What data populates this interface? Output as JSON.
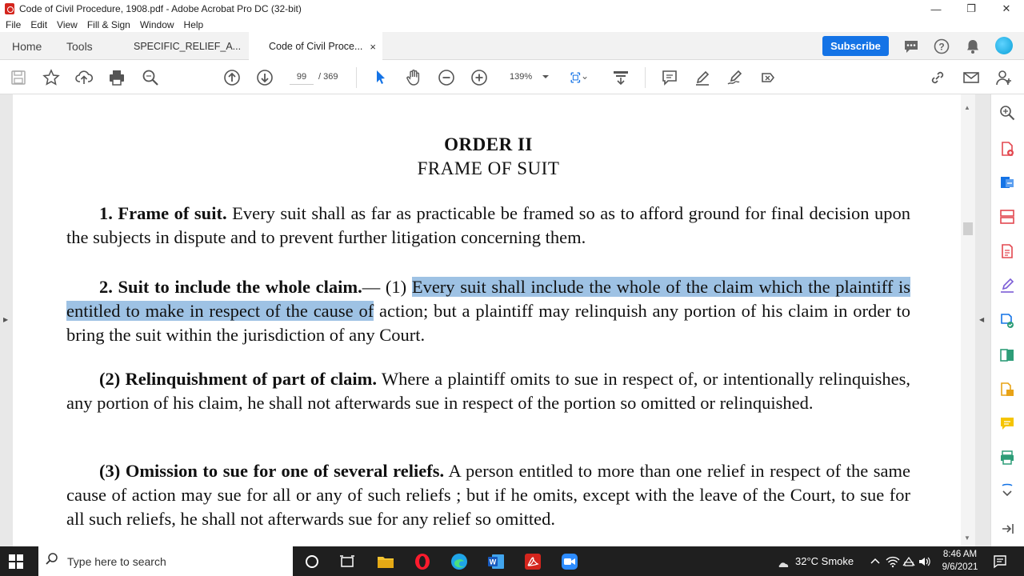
{
  "window": {
    "title": "Code of Civil Procedure, 1908.pdf - Adobe Acrobat Pro DC (32-bit)"
  },
  "menu": [
    "File",
    "Edit",
    "View",
    "Fill & Sign",
    "Window",
    "Help"
  ],
  "tabs": {
    "home": "Home",
    "tools": "Tools",
    "doc1": "SPECIFIC_RELIEF_A...",
    "doc2": "Code of Civil Proce...",
    "close": "×"
  },
  "subscribe": "Subscribe",
  "toolbar": {
    "page_current": "99",
    "page_total": "/ 369",
    "zoom": "139%"
  },
  "document": {
    "order_title": "ORDER II",
    "order_subtitle": "FRAME OF SUIT",
    "p1_head": "1. Frame of suit.",
    "p1_body": " Every suit shall as far as practicable be framed so as to afford ground for final decision upon the subjects in dispute and to prevent further litigation concerning them.",
    "p2_head": "2. Suit to include the whole claim.",
    "p2_pre": "— (1) ",
    "p2_sel1": "Every suit shall include the whole of the claim",
    "p2_sel2": " which the plaintiff is entitled to make in respect of the cause of",
    "p2_rest": " action; but a plaintiff may relinquish any portion of his claim in order to bring the suit within the jurisdiction of any Court.",
    "p3_head": "(2) Relinquishment of part of claim.",
    "p3_body": " Where a plaintiff omits to sue in respect of, or intentionally relinquishes, any portion of his claim, he shall not afterwards sue in respect of the portion so omitted or relinquished.",
    "p4_head": "(3) Omission to sue for one of several reliefs.",
    "p4_body": " A person entitled to more than one relief in respect of the same cause of action may sue for all or any of such reliefs ; but if he omits, except with the leave of the Court, to sue for all such reliefs, he shall not afterwards sue for any relief so omitted."
  },
  "taskbar": {
    "search_placeholder": "Type here to search",
    "weather": "32°C  Smoke",
    "time": "8:46 AM",
    "date": "9/6/2021"
  },
  "colors": {
    "selection": "#9ec2e4",
    "subscribe": "#1473e6",
    "acrobat_red": "#d4251d"
  }
}
